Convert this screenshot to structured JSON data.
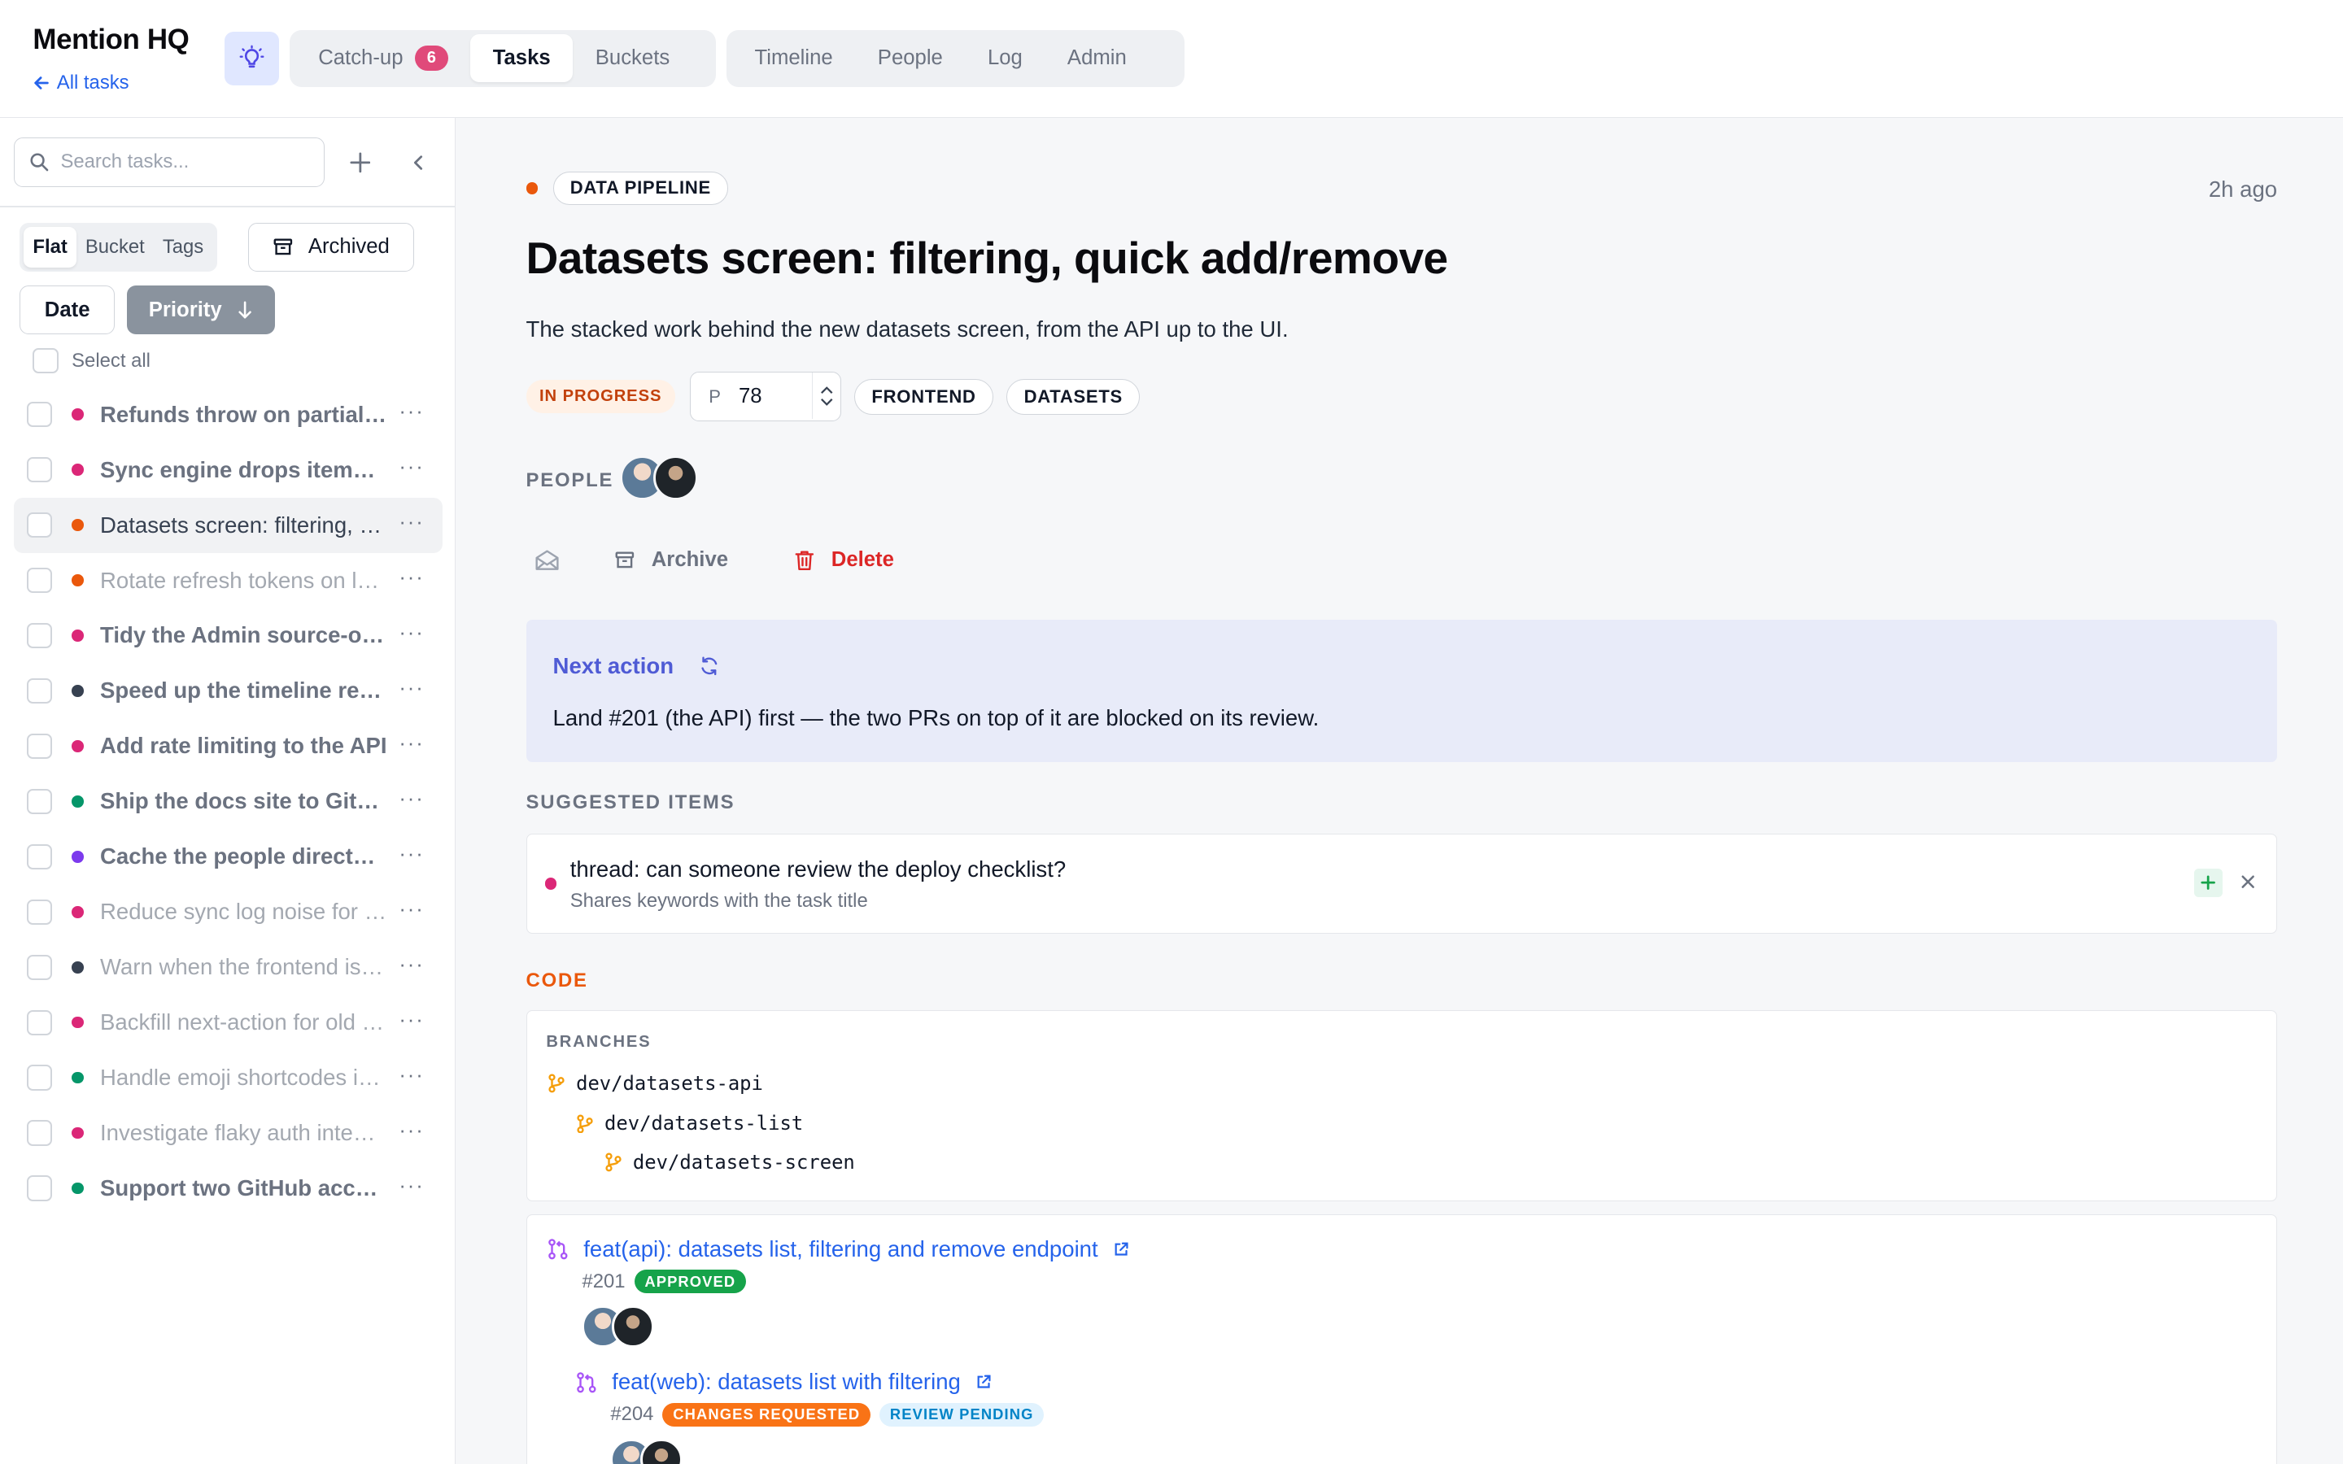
{
  "header": {
    "brand": "Mention HQ",
    "back_link": "All tasks",
    "tabs_primary": [
      {
        "label": "Catch-up",
        "count": "6"
      },
      {
        "label": "Tasks"
      },
      {
        "label": "Buckets"
      }
    ],
    "tabs_secondary": [
      {
        "label": "Timeline"
      },
      {
        "label": "People"
      },
      {
        "label": "Log"
      },
      {
        "label": "Admin"
      }
    ]
  },
  "sidebar": {
    "search_placeholder": "Search tasks...",
    "view_modes": [
      "Flat",
      "Bucket",
      "Tags"
    ],
    "archived_label": "Archived",
    "sort_date": "Date",
    "sort_priority": "Priority",
    "select_all": "Select all",
    "tasks": [
      {
        "title": "Refunds throw on partial captures",
        "color": "#db2777",
        "style": "bold"
      },
      {
        "title": "Sync engine drops items when offline",
        "color": "#db2777",
        "style": "bold"
      },
      {
        "title": "Datasets screen: filtering, quick add/remove",
        "color": "#ea580c",
        "style": "normal"
      },
      {
        "title": "Rotate refresh tokens on login",
        "color": "#ea580c",
        "style": "light"
      },
      {
        "title": "Tidy the Admin source-of-truth page",
        "color": "#db2777",
        "style": "bold"
      },
      {
        "title": "Speed up the timeline render",
        "color": "#374151",
        "style": "bold"
      },
      {
        "title": "Add rate limiting to the API",
        "color": "#db2777",
        "style": "bold"
      },
      {
        "title": "Ship the docs site to GitHub Pages",
        "color": "#059669",
        "style": "bold"
      },
      {
        "title": "Cache the people directory",
        "color": "#7c3aed",
        "style": "bold"
      },
      {
        "title": "Reduce sync log noise for bots",
        "color": "#db2777",
        "style": "light"
      },
      {
        "title": "Warn when the frontend is stale",
        "color": "#374151",
        "style": "light"
      },
      {
        "title": "Backfill next-action for old tasks",
        "color": "#db2777",
        "style": "light"
      },
      {
        "title": "Handle emoji shortcodes in titles",
        "color": "#059669",
        "style": "light"
      },
      {
        "title": "Investigate flaky auth integration tests",
        "color": "#db2777",
        "style": "light"
      },
      {
        "title": "Support two GitHub accounts",
        "color": "#059669",
        "style": "bold"
      }
    ]
  },
  "task": {
    "bucket": "DATA PIPELINE",
    "updated": "2h ago",
    "title": "Datasets screen: filtering, quick add/remove",
    "description": "The stacked work behind the new datasets screen, from the API up to the UI.",
    "status": "IN PROGRESS",
    "priority_prefix": "P",
    "priority_value": "78",
    "tags": [
      "FRONTEND",
      "DATASETS"
    ],
    "people_label": "PEOPLE",
    "actions": {
      "archive": "Archive",
      "delete": "Delete"
    },
    "next_action": {
      "title": "Next action",
      "text": "Land #201 (the API) first — the two PRs on top of it are blocked on its review."
    },
    "suggested_label": "SUGGESTED ITEMS",
    "suggested": [
      {
        "title": "thread: can someone review the deploy checklist?",
        "reason": "Shares keywords with the task title"
      }
    ],
    "code_label": "CODE",
    "branches_label": "BRANCHES",
    "branches": [
      "dev/datasets-api",
      "dev/datasets-list",
      "dev/datasets-screen"
    ],
    "prs": [
      {
        "title": "feat(api): datasets list, filtering and remove endpoint",
        "number": "#201",
        "tags": [
          "APPROVED"
        ]
      },
      {
        "title": "feat(web): datasets list with filtering",
        "number": "#204",
        "tags": [
          "CHANGES REQUESTED",
          "REVIEW PENDING"
        ]
      }
    ]
  }
}
